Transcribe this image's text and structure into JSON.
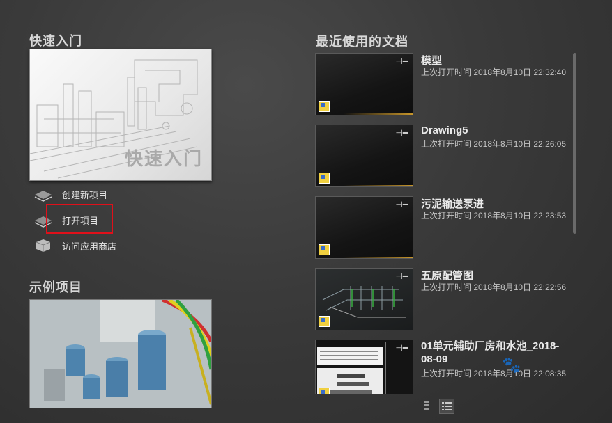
{
  "quick_start": {
    "title": "快速入门",
    "thumbnail_label": "快速入门",
    "actions": [
      {
        "label": "创建新项目",
        "icon": "create-project-icon"
      },
      {
        "label": "打开项目",
        "icon": "open-project-icon"
      },
      {
        "label": "访问应用商店",
        "icon": "app-store-icon"
      }
    ]
  },
  "sample_projects": {
    "title": "示例项目"
  },
  "recent_documents": {
    "title": "最近使用的文档",
    "items": [
      {
        "name": "模型",
        "time": "上次打开时间 2018年8月10日 22:32:40",
        "thumbnail": "dark"
      },
      {
        "name": "Drawing5",
        "time": "上次打开时间 2018年8月10日 22:26:05",
        "thumbnail": "dark"
      },
      {
        "name": "污泥输送泵进",
        "time": "上次打开时间 2018年8月10日 22:23:53",
        "thumbnail": "dark"
      },
      {
        "name": "五原配管图",
        "time": "上次打开时间 2018年8月10日 22:22:56",
        "thumbnail": "piping"
      },
      {
        "name": "01单元辅助厂房和水池_2018-08-09",
        "time": "上次打开时间 2018年8月10日 22:08:35",
        "thumbnail": "drawing"
      }
    ]
  },
  "colors": {
    "highlight": "#e0101a",
    "accent_bar": "#c8962a"
  }
}
